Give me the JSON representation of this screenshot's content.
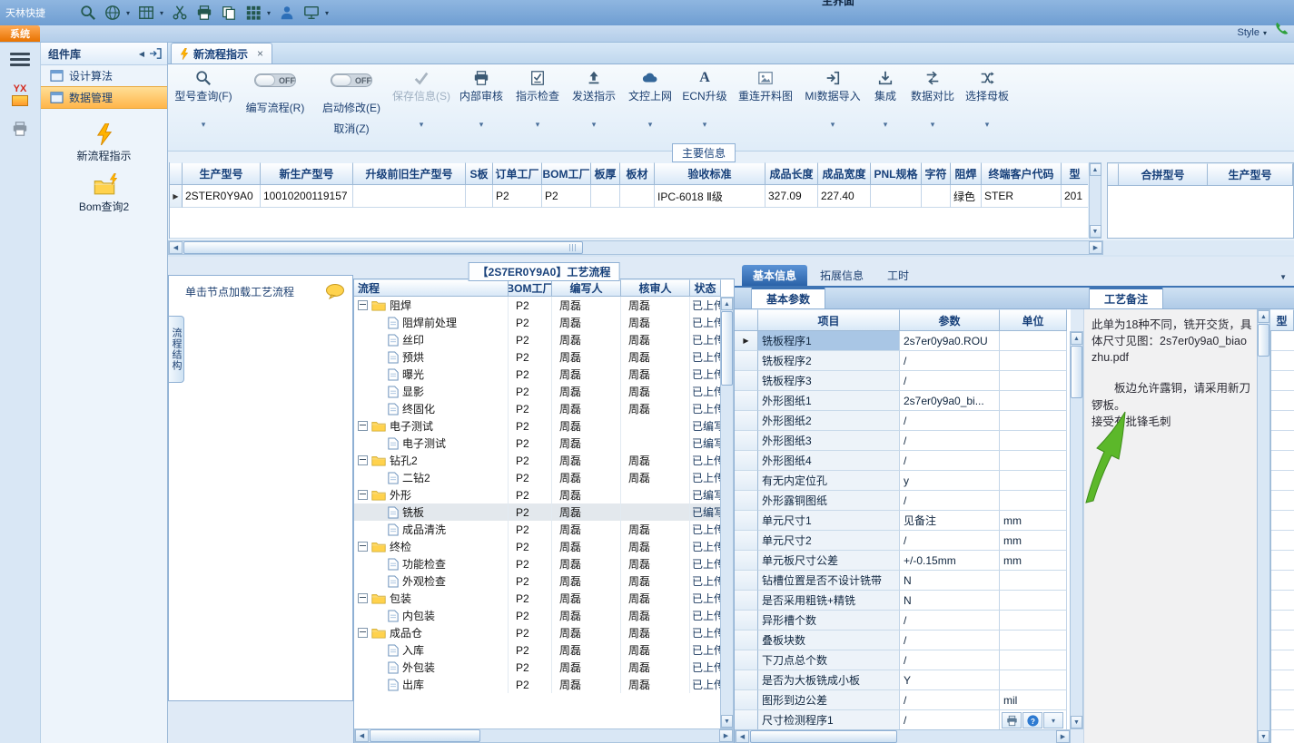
{
  "quick_toolbar": {
    "app_name": "天林快捷",
    "window_title": "主界面",
    "style_label": "Style"
  },
  "ribbon": {
    "system_tab": "系统"
  },
  "left_rail": {
    "logo_text": "YX"
  },
  "component_panel": {
    "title": "组件库",
    "items": [
      {
        "label": "设计算法"
      },
      {
        "label": "数据管理"
      }
    ],
    "shortcuts": [
      {
        "label": "新流程指示"
      },
      {
        "label": "Bom查询2"
      }
    ]
  },
  "doc_tab": {
    "label": "新流程指示"
  },
  "toolbar": {
    "model_query": "型号查询(F)",
    "write_flow_toggle": "OFF",
    "write_flow": "编写流程(R)",
    "start_edit_toggle": "OFF",
    "start_edit": "启动修改(E)",
    "cancel": "取消(Z)",
    "save": "保存信息(S)",
    "internal_audit": "内部审核",
    "instruction_check": "指示检查",
    "send_instruction": "发送指示",
    "doc_upload": "文控上网",
    "ecn_upgrade": "ECN升级",
    "reconnect_drawing": "重连开料图",
    "mi_import": "MI数据导入",
    "integrate": "集成",
    "data_compare": "数据对比",
    "select_master": "选择母板"
  },
  "main_grid": {
    "section_title": "主要信息",
    "cols": [
      {
        "label": "生产型号",
        "val": "2STER0Y9A0"
      },
      {
        "label": "新生产型号",
        "val": "10010200119157"
      },
      {
        "label": "升级前旧生产型号",
        "val": ""
      },
      {
        "label": "S板",
        "val": ""
      },
      {
        "label": "订单工厂",
        "val": "P2"
      },
      {
        "label": "BOM工厂",
        "val": "P2"
      },
      {
        "label": "板厚",
        "val": ""
      },
      {
        "label": "板材",
        "val": ""
      },
      {
        "label": "验收标准",
        "val": "IPC-6018 Ⅱ级"
      },
      {
        "label": "成品长度",
        "val": "327.09"
      },
      {
        "label": "成品宽度",
        "val": "227.40"
      },
      {
        "label": "PNL规格",
        "val": ""
      },
      {
        "label": "字符",
        "val": ""
      },
      {
        "label": "阻焊",
        "val": "绿色"
      },
      {
        "label": "终端客户代码",
        "val": "STER"
      },
      {
        "label": "型",
        "val": "201"
      }
    ],
    "pair_cols": [
      {
        "label": "合拼型号"
      },
      {
        "label": "生产型号"
      }
    ]
  },
  "flow_panel": {
    "side_tab": "流程结构",
    "hint": "单击节点加载工艺流程",
    "title": "【2S7ER0Y9A0】工艺流程",
    "columns": [
      "流程",
      "BOM工厂",
      "编写人",
      "核审人",
      "状态"
    ],
    "rows": [
      {
        "name": "阻焊",
        "type": "folder",
        "bom": "P2",
        "writer": "周磊",
        "reviewer": "周磊",
        "status": "已上传"
      },
      {
        "name": "阻焊前处理",
        "type": "leaf",
        "bom": "P2",
        "writer": "周磊",
        "reviewer": "周磊",
        "status": "已上传"
      },
      {
        "name": "丝印",
        "type": "leaf",
        "bom": "P2",
        "writer": "周磊",
        "reviewer": "周磊",
        "status": "已上传"
      },
      {
        "name": "预烘",
        "type": "leaf",
        "bom": "P2",
        "writer": "周磊",
        "reviewer": "周磊",
        "status": "已上传"
      },
      {
        "name": "曝光",
        "type": "leaf",
        "bom": "P2",
        "writer": "周磊",
        "reviewer": "周磊",
        "status": "已上传"
      },
      {
        "name": "显影",
        "type": "leaf",
        "bom": "P2",
        "writer": "周磊",
        "reviewer": "周磊",
        "status": "已上传"
      },
      {
        "name": "终固化",
        "type": "leaf",
        "bom": "P2",
        "writer": "周磊",
        "reviewer": "周磊",
        "status": "已上传"
      },
      {
        "name": "电子测试",
        "type": "folder",
        "bom": "P2",
        "writer": "周磊",
        "reviewer": "",
        "status": "已编写"
      },
      {
        "name": "电子测试",
        "type": "leaf",
        "bom": "P2",
        "writer": "周磊",
        "reviewer": "",
        "status": "已编写"
      },
      {
        "name": "钻孔2",
        "type": "folder",
        "bom": "P2",
        "writer": "周磊",
        "reviewer": "周磊",
        "status": "已上传"
      },
      {
        "name": "二钻2",
        "type": "leaf",
        "bom": "P2",
        "writer": "周磊",
        "reviewer": "周磊",
        "status": "已上传"
      },
      {
        "name": "外形",
        "type": "folder",
        "bom": "P2",
        "writer": "周磊",
        "reviewer": "",
        "status": "已编写"
      },
      {
        "name": "铣板",
        "type": "leaf",
        "bom": "P2",
        "writer": "周磊",
        "reviewer": "",
        "status": "已编写",
        "sel": true
      },
      {
        "name": "成品清洗",
        "type": "leaf",
        "bom": "P2",
        "writer": "周磊",
        "reviewer": "周磊",
        "status": "已上传"
      },
      {
        "name": "终检",
        "type": "folder",
        "bom": "P2",
        "writer": "周磊",
        "reviewer": "周磊",
        "status": "已上传"
      },
      {
        "name": "功能检查",
        "type": "leaf",
        "bom": "P2",
        "writer": "周磊",
        "reviewer": "周磊",
        "status": "已上传"
      },
      {
        "name": "外观检查",
        "type": "leaf",
        "bom": "P2",
        "writer": "周磊",
        "reviewer": "周磊",
        "status": "已上传"
      },
      {
        "name": "包装",
        "type": "folder",
        "bom": "P2",
        "writer": "周磊",
        "reviewer": "周磊",
        "status": "已上传"
      },
      {
        "name": "内包装",
        "type": "leaf",
        "bom": "P2",
        "writer": "周磊",
        "reviewer": "周磊",
        "status": "已上传"
      },
      {
        "name": "成品仓",
        "type": "folder",
        "bom": "P2",
        "writer": "周磊",
        "reviewer": "周磊",
        "status": "已上传"
      },
      {
        "name": "入库",
        "type": "leaf",
        "bom": "P2",
        "writer": "周磊",
        "reviewer": "周磊",
        "status": "已上传"
      },
      {
        "name": "外包装",
        "type": "leaf",
        "bom": "P2",
        "writer": "周磊",
        "reviewer": "周磊",
        "status": "已上传"
      },
      {
        "name": "出库",
        "type": "leaf",
        "bom": "P2",
        "writer": "周磊",
        "reviewer": "周磊",
        "status": "已上传"
      }
    ]
  },
  "detail_panel": {
    "tabs": [
      "基本信息",
      "拓展信息",
      "工时"
    ],
    "param_tab": "基本参数",
    "columns": [
      "项目",
      "参数",
      "单位"
    ],
    "rows": [
      {
        "item": "铣板程序1",
        "param": "2s7er0y9a0.ROU",
        "unit": "",
        "sel": true
      },
      {
        "item": "铣板程序2",
        "param": "/",
        "unit": ""
      },
      {
        "item": "铣板程序3",
        "param": "/",
        "unit": ""
      },
      {
        "item": "外形图纸1",
        "param": "2s7er0y9a0_bi...",
        "unit": ""
      },
      {
        "item": "外形图纸2",
        "param": "/",
        "unit": ""
      },
      {
        "item": "外形图纸3",
        "param": "/",
        "unit": ""
      },
      {
        "item": "外形图纸4",
        "param": "/",
        "unit": ""
      },
      {
        "item": "有无内定位孔",
        "param": "y",
        "unit": ""
      },
      {
        "item": "外形露铜图纸",
        "param": "/",
        "unit": ""
      },
      {
        "item": "单元尺寸1",
        "param": "见备注",
        "unit": "mm"
      },
      {
        "item": "单元尺寸2",
        "param": "/",
        "unit": "mm"
      },
      {
        "item": "单元板尺寸公差",
        "param": "+/-0.15mm",
        "unit": "mm"
      },
      {
        "item": "钻槽位置是否不设计铣带",
        "param": "N",
        "unit": ""
      },
      {
        "item": "是否采用粗铣+精铣",
        "param": "N",
        "unit": ""
      },
      {
        "item": "异形槽个数",
        "param": "/",
        "unit": ""
      },
      {
        "item": "叠板块数",
        "param": "/",
        "unit": ""
      },
      {
        "item": "下刀点总个数",
        "param": "/",
        "unit": ""
      },
      {
        "item": "是否为大板铣成小板",
        "param": "Y",
        "unit": ""
      },
      {
        "item": "图形到边公差",
        "param": "/",
        "unit": "mil"
      },
      {
        "item": "尺寸检测程序1",
        "param": "/",
        "unit": ""
      }
    ]
  },
  "remarks": {
    "tab": "工艺备注",
    "paragraphs": [
      "此单为18种不同，铣开交货，具体尺寸见图：2s7er0y9a0_biaozhu.pdf",
      "板边允许露铜，请采用新刀锣板。",
      "接受有批锋毛刺"
    ],
    "clipped_col_header": "型"
  },
  "colors": {
    "accent_orange": "#ff9a2e",
    "header_text": "#17407a",
    "tab_active_blue": "#2e68ae",
    "annotation_green": "#5cb82a"
  }
}
